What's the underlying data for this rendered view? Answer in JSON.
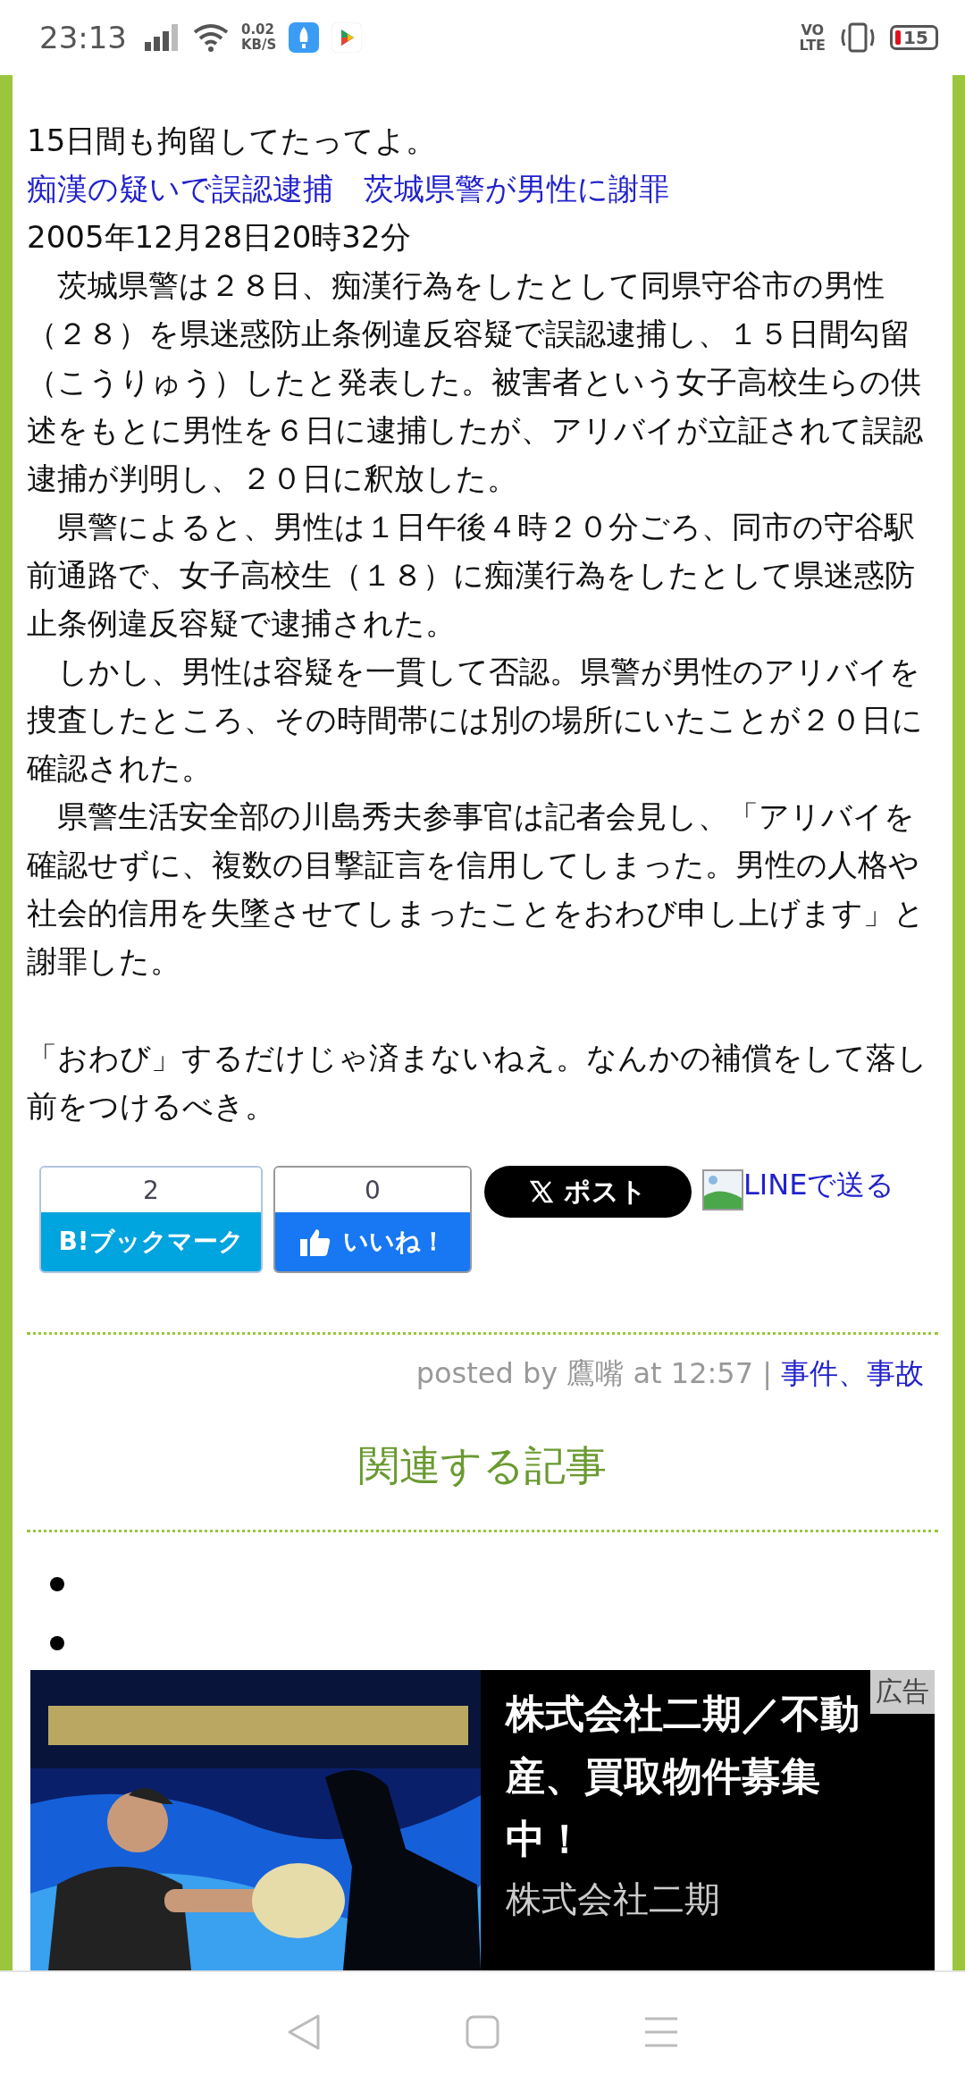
{
  "status_bar": {
    "time": "23:13",
    "net_speed": [
      "0.02",
      "KB/S"
    ],
    "volte": [
      "VO",
      "LTE"
    ],
    "battery": "15"
  },
  "article": {
    "intro": "15日間も拘留してたってよ。",
    "headline": "痴漢の疑いで誤認逮捕　茨城県警が男性に謝罪",
    "date": "2005年12月28日20時32分",
    "paragraphs": [
      "　茨城県警は２８日、痴漢行為をしたとして同県守谷市の男性（２８）を県迷惑防止条例違反容疑で誤認逮捕し、１５日間勾留（こうりゅう）したと発表した。被害者という女子高校生らの供述をもとに男性を６日に逮捕したが、アリバイが立証されて誤認逮捕が判明し、２０日に釈放した。",
      "　県警によると、男性は１日午後４時２０分ごろ、同市の守谷駅前通路で、女子高校生（１８）に痴漢行為をしたとして県迷惑防止条例違反容疑で逮捕された。",
      "　しかし、男性は容疑を一貫して否認。県警が男性のアリバイを捜査したところ、その時間帯には別の場所にいたことが２０日に確認された。",
      "　県警生活安全部の川島秀夫参事官は記者会見し、「アリバイを確認せずに、複数の目撃証言を信用してしまった。男性の人格や社会的信用を失墜させてしまったことをおわび申し上げます」と謝罪した。"
    ],
    "comment": "「おわび」するだけじゃ済まないねえ。なんかの補償をして落し前をつけるべき。"
  },
  "share": {
    "bookmark": {
      "count": "2",
      "label": "B!ブックマーク"
    },
    "like": {
      "count": "0",
      "label": "いいね！"
    },
    "post": {
      "label": "ポスト"
    },
    "line": {
      "label": "LINEで送る"
    }
  },
  "footer": {
    "posted_by": "posted by 鷹嘴 at 12:57 |",
    "category": "事件、事故"
  },
  "related": {
    "title": "関連する記事",
    "items": [
      {
        "kind": "bullet"
      },
      {
        "kind": "bullet"
      }
    ]
  },
  "ad": {
    "badge": "広告",
    "title": "株式会社二期／不動産、買取物件募集中！",
    "advertiser": "株式会社二期"
  }
}
